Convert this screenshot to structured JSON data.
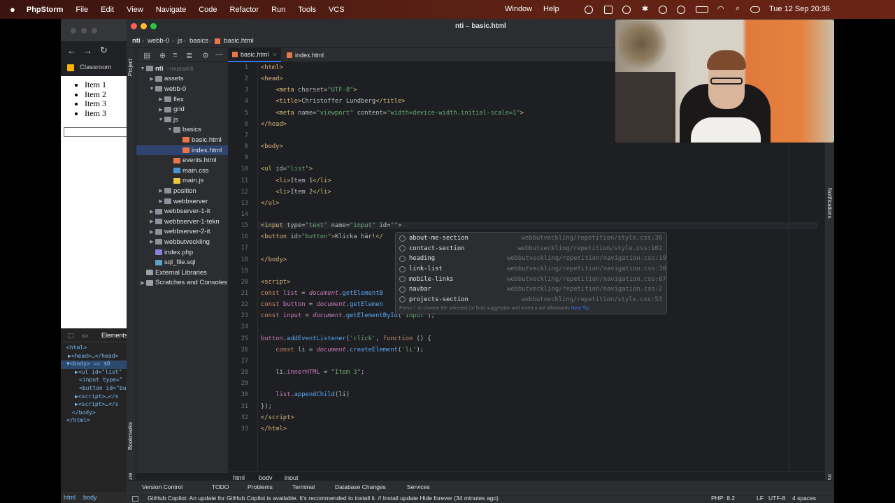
{
  "menubar": {
    "app": "PhpStorm",
    "items": [
      "File",
      "Edit",
      "View",
      "Navigate",
      "Code",
      "Refactor",
      "Run",
      "Tools",
      "VCS"
    ],
    "right_items": [
      "Window",
      "Help"
    ],
    "clock": "Tue 12 Sep  20:36"
  },
  "browser": {
    "tab_label": "Classroom",
    "list_items": [
      "Item 1",
      "Item 2",
      "Item 3",
      "Item 3"
    ],
    "devtools": {
      "tab": "Elements",
      "lines": [
        "<html>",
        "▶<head>…</head>",
        "▼<body> == $0",
        "▶<ul id=\"list\"",
        "<input type=\"",
        "<button id=\"bu",
        "▶<script>…</s",
        "▶<script>…</s",
        "</body>",
        "</html>"
      ],
      "crumbs": [
        "html",
        "body"
      ]
    }
  },
  "ide": {
    "title": "nti – basic.html",
    "breadcrumb": [
      "nti",
      "webb-0",
      "js",
      "basics",
      "basic.html"
    ],
    "project_root": "nti",
    "project_root_path": "~/repos/nti",
    "tree": [
      {
        "label": "assets",
        "type": "folder",
        "depth": 1,
        "arrow": "▶"
      },
      {
        "label": "webb-0",
        "type": "folder",
        "depth": 1,
        "arrow": "▼"
      },
      {
        "label": "flex",
        "type": "folder",
        "depth": 2,
        "arrow": "▶"
      },
      {
        "label": "grid",
        "type": "folder",
        "depth": 2,
        "arrow": "▶"
      },
      {
        "label": "js",
        "type": "folder",
        "depth": 2,
        "arrow": "▼"
      },
      {
        "label": "basics",
        "type": "folder",
        "depth": 3,
        "arrow": "▼"
      },
      {
        "label": "basic.html",
        "type": "html",
        "depth": 4,
        "arrow": ""
      },
      {
        "label": "index.html",
        "type": "html",
        "depth": 4,
        "arrow": "",
        "selected": true
      },
      {
        "label": "events.html",
        "type": "html",
        "depth": 3,
        "arrow": ""
      },
      {
        "label": "main.css",
        "type": "css",
        "depth": 3,
        "arrow": ""
      },
      {
        "label": "main.js",
        "type": "js",
        "depth": 3,
        "arrow": ""
      },
      {
        "label": "position",
        "type": "folder",
        "depth": 2,
        "arrow": "▶"
      },
      {
        "label": "webbserver",
        "type": "folder",
        "depth": 2,
        "arrow": "▶"
      },
      {
        "label": "webbserver-1-it",
        "type": "folder",
        "depth": 1,
        "arrow": "▶"
      },
      {
        "label": "webbserver-1-tekn",
        "type": "folder",
        "depth": 1,
        "arrow": "▶"
      },
      {
        "label": "webbserver-2-it",
        "type": "folder",
        "depth": 1,
        "arrow": "▶"
      },
      {
        "label": "webbutveckling",
        "type": "folder",
        "depth": 1,
        "arrow": "▶"
      },
      {
        "label": "index.php",
        "type": "php",
        "depth": 1,
        "arrow": ""
      },
      {
        "label": "sql_file.sql",
        "type": "sql",
        "depth": 1,
        "arrow": ""
      },
      {
        "label": "External Libraries",
        "type": "lib",
        "depth": 0,
        "arrow": ""
      },
      {
        "label": "Scratches and Consoles",
        "type": "lib",
        "depth": 0,
        "arrow": "▶"
      }
    ],
    "tabs": [
      "basic.html",
      "index.html"
    ],
    "side_labels": {
      "project": "Project",
      "bookmarks": "Bookmarks",
      "structure": "Structure",
      "notifications": "Notifications",
      "make": "make"
    },
    "autocomplete": {
      "items": [
        {
          "name": "about-me-section",
          "source": "webbutveckling/repetition/style.css:36"
        },
        {
          "name": "contact-section",
          "source": "webbutveckling/repetition/style.css:102"
        },
        {
          "name": "heading",
          "source": "webbutveckling/repetition/navigation.css:19"
        },
        {
          "name": "link-list",
          "source": "webbutveckling/repetition/navigation.css:30"
        },
        {
          "name": "mobile-links",
          "source": "webbutveckling/repetition/navigation.css:67"
        },
        {
          "name": "navbar",
          "source": "webbutveckling/repetition/navigation.css:2"
        },
        {
          "name": "projects-section",
          "source": "webbutveckling/repetition/style.css:53"
        }
      ],
      "hint": "Press ^. to choose the selected (or first) suggestion and insert a dot afterwards",
      "hint_link": "Next Tip"
    },
    "code_crumbs": [
      "html",
      "body",
      "input"
    ],
    "toolwindows": [
      "Version Control",
      "TODO",
      "Problems",
      "Terminal",
      "Database Changes",
      "Services"
    ],
    "status": {
      "message": "GitHub Copilot: An update for GitHub Copilot is available. It's recommended to install it. // Install update   Hide forever (34 minutes ago)",
      "php": "PHP: 8.2",
      "line_sep": "LF",
      "encoding": "UTF-8",
      "indent": "4 spaces"
    }
  }
}
